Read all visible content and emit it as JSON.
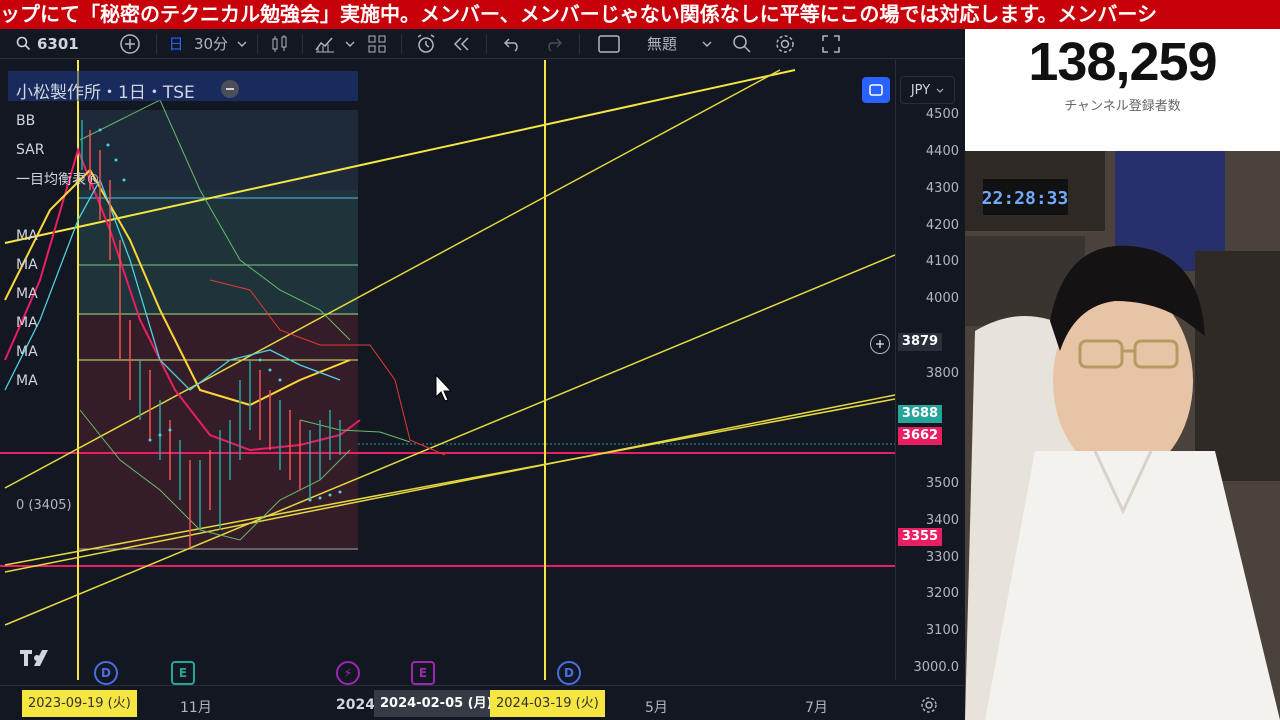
{
  "ticker_text": "ップにて「秘密のテクニカル勉強会」実施中。メンバー、メンバーじゃない関係なしに平等にこの場では対応します。メンバーシ",
  "toolbar": {
    "symbol": "6301",
    "interval_icon": "日",
    "interval": "30分",
    "layout_name": "無題",
    "icons": [
      "search-icon",
      "add-icon",
      "candles-icon",
      "indicators-icon",
      "templates-icon",
      "alert-icon",
      "replay-icon",
      "undo-icon",
      "redo-icon",
      "layout-icon",
      "search-icon",
      "settings-icon",
      "fullscreen-icon"
    ]
  },
  "chart": {
    "title": "小松製作所・1日・TSE",
    "currency": "JPY",
    "indicators": [
      "BB",
      "SAR",
      "一目均衡表®",
      "MA",
      "MA",
      "MA",
      "MA",
      "MA",
      "MA"
    ],
    "fib_label": "0 (3405)",
    "price_ticks": [
      "4500",
      "4400",
      "4300",
      "4200",
      "4100",
      "4000",
      "3900",
      "3800",
      "3700",
      "3600",
      "3500",
      "3400",
      "3300",
      "3200",
      "3100",
      "3000.0"
    ],
    "price_tags": [
      {
        "value": "3879",
        "color": "#2a2e39"
      },
      {
        "value": "3688",
        "color": "#26a69a"
      },
      {
        "value": "3662",
        "color": "#e91e63"
      },
      {
        "value": "3355",
        "color": "#e91e63"
      }
    ],
    "time_labels": [
      "11月",
      "2024",
      "5月",
      "7月"
    ],
    "date_tags": [
      {
        "text": "2023-09-19 (火)",
        "bg": "#f5e642",
        "fg": "#333"
      },
      {
        "text": "2024-02-05 (月)",
        "bg": "#363a45",
        "fg": "#fff"
      },
      {
        "text": "2024-03-19 (火)",
        "bg": "#f5e642",
        "fg": "#333"
      }
    ],
    "events": [
      {
        "label": "D",
        "color": "#4a6ee0"
      },
      {
        "label": "E",
        "color": "#26a69a"
      },
      {
        "label": "⚡",
        "color": "#9c27b0"
      },
      {
        "label": "E",
        "color": "#9c27b0"
      },
      {
        "label": "D",
        "color": "#4a6ee0"
      }
    ]
  },
  "subscribers": {
    "count": "138,259",
    "label": "チャンネル登録者数"
  },
  "webcam": {
    "clock": "22:28:33"
  }
}
